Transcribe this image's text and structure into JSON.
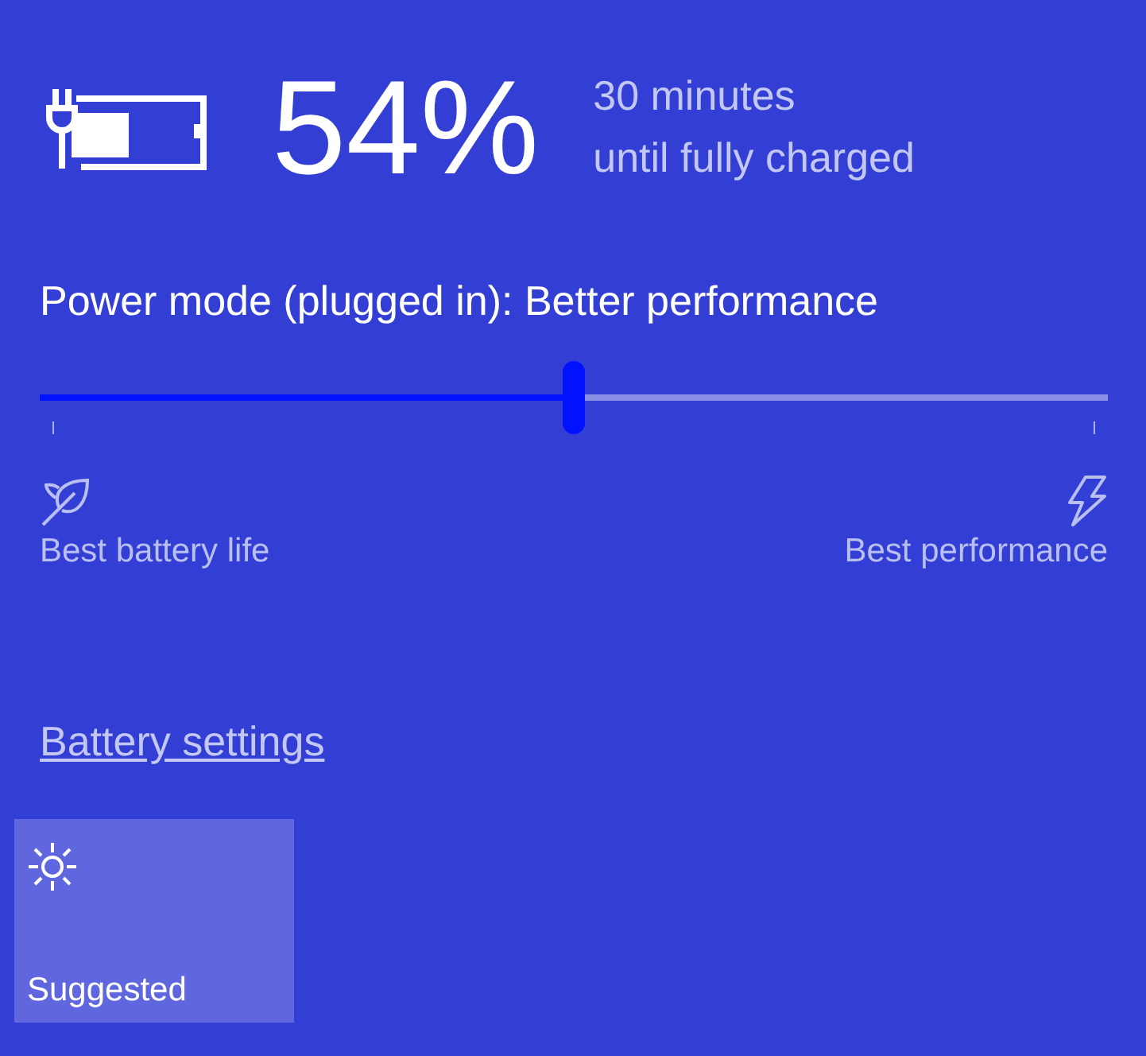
{
  "battery": {
    "percent": "54%",
    "estimate": [
      "30 minutes",
      "until fully charged"
    ]
  },
  "power_mode": {
    "label": "Power mode (plugged in): Better performance",
    "level": 0.5,
    "min_label": "Best battery life",
    "max_label": "Best performance"
  },
  "link": "Battery settings",
  "quick_actions": [
    {
      "label": "Suggested",
      "on": false
    }
  ]
}
